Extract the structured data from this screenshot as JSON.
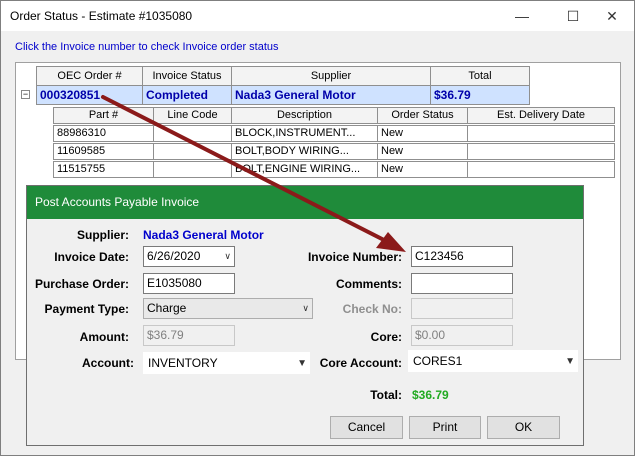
{
  "window": {
    "title": "Order Status - Estimate #1035080",
    "minimize_glyph": "—",
    "maximize_glyph": "☐",
    "close_glyph": "✕"
  },
  "hint": "Click the Invoice number to check Invoice order status",
  "grid": {
    "columns": [
      "OEC Order #",
      "Invoice Status",
      "Supplier",
      "Total"
    ],
    "expander": "−",
    "row": {
      "order": "000320851",
      "status": "Completed",
      "supplier": "Nada3 General Motor",
      "total": "$36.79"
    },
    "sub_columns": [
      "Part #",
      "Line Code",
      "Description",
      "Order Status",
      "Est. Delivery Date"
    ],
    "sub_rows": [
      {
        "part": "88986310",
        "line_code": "",
        "description": "BLOCK,INSTRUMENT...",
        "status": "New",
        "delivery": ""
      },
      {
        "part": "11609585",
        "line_code": "",
        "description": "BOLT,BODY WIRING...",
        "status": "New",
        "delivery": ""
      },
      {
        "part": "11515755",
        "line_code": "",
        "description": "BOLT,ENGINE WIRING...",
        "status": "New",
        "delivery": ""
      }
    ]
  },
  "dialog": {
    "title": "Post Accounts Payable Invoice",
    "supplier_label": "Supplier:",
    "supplier_value": "Nada3  General Motor",
    "invoice_date_label": "Invoice Date:",
    "invoice_date_value": "6/26/2020",
    "purchase_order_label": "Purchase Order:",
    "purchase_order_value": "E1035080",
    "payment_type_label": "Payment Type:",
    "payment_type_value": "Charge",
    "amount_label": "Amount:",
    "amount_value": "$36.79",
    "account_label": "Account:",
    "account_value": "INVENTORY",
    "invoice_number_label": "Invoice Number:",
    "invoice_number_value": "C123456",
    "comments_label": "Comments:",
    "comments_value": "",
    "check_no_label": "Check No:",
    "check_no_value": "",
    "core_label": "Core:",
    "core_value": "$0.00",
    "core_account_label": "Core Account:",
    "core_account_value": "CORES1",
    "total_label": "Total:",
    "total_value": "$36.79",
    "cancel_label": "Cancel",
    "print_label": "Print",
    "ok_label": "OK"
  },
  "colors": {
    "dialog_title_bg": "#1f8b3a",
    "hint_text": "#0000cc",
    "total_value": "#22aa22",
    "annotation_arrow": "#8b1a1a"
  }
}
